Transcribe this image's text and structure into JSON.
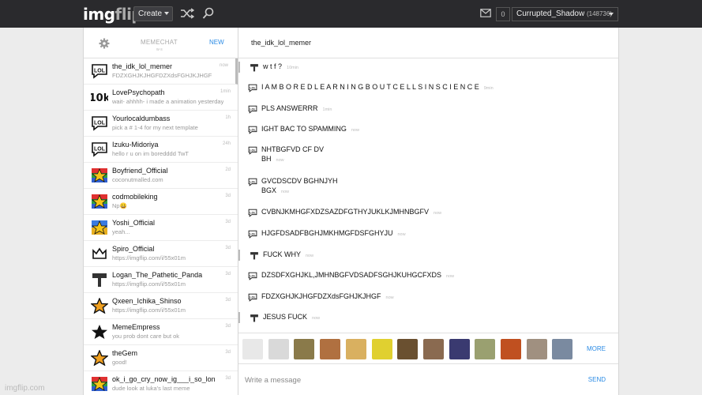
{
  "header": {
    "logo_part1": "img",
    "logo_part2": "flip",
    "create_label": "Create",
    "notif_count": "0",
    "username": "Currupted_Shadow",
    "user_points": "(148736)"
  },
  "sidebar": {
    "title": "MEMECHAT",
    "subtitle": "w·s",
    "new_label": "NEW",
    "conversations": [
      {
        "name": "the_idk_lol_memer",
        "preview": "FDZXGHJKJHGFDZXdsFGHJKJHGF",
        "time": "now",
        "avatar": "lol"
      },
      {
        "name": "LovePsychopath",
        "preview": "wait- ahhhh- i made a animation yesterday",
        "time": "1min",
        "avatar": "10k"
      },
      {
        "name": "Yourlocaldumbass",
        "preview": "pick a # 1-4 for my next template",
        "time": "1h",
        "avatar": "lol"
      },
      {
        "name": "Izuku-Midoriya",
        "preview": "hello r u on im boredddd TwT",
        "time": "24h",
        "avatar": "lol"
      },
      {
        "name": "Boyfriend_Official",
        "preview": "coconutmalled.com",
        "time": "2d",
        "avatar": "star-flag"
      },
      {
        "name": "codmobileking",
        "preview": "Np😀",
        "time": "3d",
        "avatar": "star-flag"
      },
      {
        "name": "Yoshi_Official",
        "preview": "yeah...",
        "time": "3d",
        "avatar": "star-blue"
      },
      {
        "name": "Spiro_Official",
        "preview": "https://imgflip.com/i/55x01m",
        "time": "3d",
        "avatar": "crown"
      },
      {
        "name": "Logan_The_Pathetic_Panda",
        "preview": "https://imgflip.com/i/55x01m",
        "time": "3d",
        "avatar": "hammer"
      },
      {
        "name": "Qxeen_Ichika_Shinso",
        "preview": "https://imgflip.com/i/55x01m",
        "time": "3d",
        "avatar": "star-outline"
      },
      {
        "name": "MemeEmpress",
        "preview": "you prob dont care but ok",
        "time": "3d",
        "avatar": "star-black"
      },
      {
        "name": "theGem",
        "preview": "good!",
        "time": "3d",
        "avatar": "star-outline"
      },
      {
        "name": "ok_i_go_cry_now_ig___i_so_lon",
        "preview": "dude look at luka's last meme",
        "time": "3d",
        "avatar": "star-flag"
      }
    ]
  },
  "chat": {
    "title": "the_idk_lol_memer",
    "messages": [
      {
        "text": "w t f ?",
        "time": "10min",
        "icon": "hammer",
        "mine": true
      },
      {
        "text": "I A M B O R E D L E A R N I N G B O U T C E L L S I N S C I E N C E",
        "time": "9min",
        "icon": "lol",
        "mine": false
      },
      {
        "text": "PLS ANSWERRR",
        "time": "1min",
        "icon": "lol",
        "mine": false
      },
      {
        "text": "IGHT BAC TO SPAMMING",
        "time": "now",
        "icon": "lol",
        "mine": false
      },
      {
        "text": "NHTBGFVD CF DV\nBH",
        "time": "now",
        "icon": "lol",
        "mine": false
      },
      {
        "text": "GVCDSCDV BGHNJYH\nBGX",
        "time": "now",
        "icon": "lol",
        "mine": false
      },
      {
        "text": "CVBNJKMHGFXDZSAZDFGTHYJUKLKJMHNBGFV",
        "time": "now",
        "icon": "lol",
        "mine": false
      },
      {
        "text": "HJGFDSADFBGHJMKHMGFDSFGHYJU",
        "time": "now",
        "icon": "lol",
        "mine": false
      },
      {
        "text": "FUCK WHY",
        "time": "now",
        "icon": "hammer",
        "mine": true
      },
      {
        "text": "DZSDFXGHJKL,JMHNBGFVDSADFSGHJKUHGCFXDS",
        "time": "now",
        "icon": "lol",
        "mine": false
      },
      {
        "text": "FDZXGHJKJHGFDZXdsFGHJKJHGF",
        "time": "now",
        "icon": "lol",
        "mine": false
      },
      {
        "text": "JESUS FUCK",
        "time": "now",
        "icon": "hammer",
        "mine": true
      }
    ],
    "emoji_names": [
      "troll-face",
      "rage-face",
      "sax-guy",
      "meme-man",
      "doge",
      "spongebob",
      "leo-toast",
      "city-photo",
      "face-photo",
      "dog-photo",
      "art-photo",
      "man-photo",
      "bw-photo"
    ],
    "emoji_colors": [
      "#e8e8e8",
      "#d9d9d9",
      "#8a7a4a",
      "#b07040",
      "#d9b060",
      "#e0d030",
      "#6a5030",
      "#8a6a50",
      "#3a3a70",
      "#9aa070",
      "#c05020",
      "#a09080",
      "#7a8aa0"
    ],
    "more_label": "MORE",
    "input_placeholder": "Write a message",
    "send_label": "SEND"
  },
  "footer": {
    "text": "imgflip.com"
  }
}
